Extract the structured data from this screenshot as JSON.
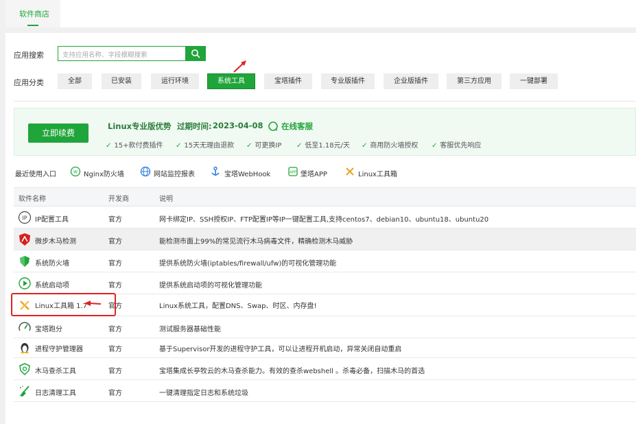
{
  "header": {
    "active_tab": "软件商店"
  },
  "search": {
    "label": "应用搜索",
    "placeholder": "支持应用名称、字段模糊搜索"
  },
  "categories": {
    "label": "应用分类",
    "items": [
      "全部",
      "已安装",
      "运行环境",
      "系统工具",
      "宝塔插件",
      "专业版插件",
      "企业版插件",
      "第三方应用",
      "一键部署"
    ],
    "active": "系统工具"
  },
  "promo": {
    "button": "立即续费",
    "title": "Linux专业版优势",
    "expire_label": "过期时间:",
    "expire_date": "2023-04-08",
    "service": "在线客服",
    "features": [
      "15+款付费插件",
      "15天无理由退款",
      "可更换IP",
      "低至1.18元/天",
      "商用防火墙授权",
      "客服优先响应"
    ]
  },
  "recent": {
    "label": "最近使用入口",
    "items": [
      "Nginx防火墙",
      "网站监控报表",
      "宝塔WebHook",
      "堡塔APP",
      "Linux工具箱"
    ]
  },
  "table": {
    "headers": [
      "软件名称",
      "开发商",
      "说明"
    ],
    "rows": [
      {
        "name": "IP配置工具",
        "dev": "官方",
        "desc": "网卡绑定IP、SSH授权IP、FTP配置IP等IP一键配置工具,支持centos7、debian10、ubuntu18、ubuntu20",
        "icon": "ip-icon"
      },
      {
        "name": "微步木马检测",
        "dev": "官方",
        "desc": "能检测市面上99%的常见流行木马病毒文件，精确检测木马威胁",
        "icon": "weibu-icon"
      },
      {
        "name": "系统防火墙",
        "dev": "官方",
        "desc": "提供系统防火墙(iptables/firewall/ufw)的可视化管理功能",
        "icon": "firewall-shield-icon"
      },
      {
        "name": "系统启动项",
        "dev": "官方",
        "desc": "提供系统启动项的可视化管理功能",
        "icon": "play-circle-icon"
      },
      {
        "name": "Linux工具箱 1.7",
        "dev": "官方",
        "desc": "Linux系统工具，配置DNS、Swap、时区、内存盘!",
        "icon": "toolbox-icon"
      },
      {
        "name": "宝塔跑分",
        "dev": "官方",
        "desc": "测试服务器基础性能",
        "icon": "gauge-icon"
      },
      {
        "name": "进程守护管理器",
        "dev": "官方",
        "desc": "基于Supervisor开发的进程守护工具，可以让进程开机启动，异常关闭自动重启",
        "icon": "linux-penguin-icon"
      },
      {
        "name": "木马查杀工具",
        "dev": "官方",
        "desc": "宝塔集成长亭牧云的木马查杀能力。有效的查杀webshell 。杀毒必备，扫描木马的首选",
        "icon": "scan-shield-icon"
      },
      {
        "name": "日志清理工具",
        "dev": "官方",
        "desc": "一键清理指定日志和系统垃圾",
        "icon": "broom-icon"
      }
    ]
  },
  "colors": {
    "accent": "#20a53a",
    "annotation": "#e02020"
  }
}
